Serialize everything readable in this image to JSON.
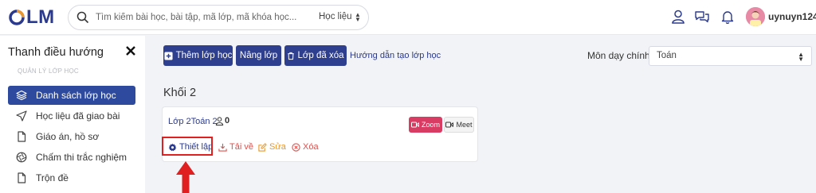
{
  "app": {
    "logo_text": "LM",
    "brand_color": "#2b3a8c"
  },
  "header": {
    "search_placeholder": "Tìm kiếm bài học, bài tập, mã lớp, mã khóa học...",
    "search_scope": "Học liệu",
    "icons": [
      "user-icon",
      "chat-icon",
      "bell-icon"
    ],
    "username": "uynuyn124"
  },
  "sidebar": {
    "title": "Thanh điều hướng",
    "section": "QUẢN LÝ LỚP HỌC",
    "items": [
      {
        "label": "Danh sách lớp học",
        "icon": "layers-icon",
        "active": true
      },
      {
        "label": "Học liệu đã giao bài",
        "icon": "send-icon",
        "active": false
      },
      {
        "label": "Giáo án, hồ sơ",
        "icon": "file-icon",
        "active": false
      },
      {
        "label": "Chấm thi trắc nghiệm",
        "icon": "aperture-icon",
        "active": false
      },
      {
        "label": "Trộn đề",
        "icon": "file-icon",
        "active": false
      }
    ]
  },
  "toolbar": {
    "add_class": "Thêm lớp học",
    "upgrade_class": "Nâng lớp",
    "deleted_classes": "Lớp đã xóa",
    "help_link": "Hướng dẫn tạo lớp học",
    "subject_label": "Môn dạy chính",
    "subject_value": "Toán"
  },
  "grade": {
    "title": "Khối 2"
  },
  "class_card": {
    "name": "Lớp 2Toán 2",
    "student_count": "0",
    "zoom_label": "Zoom",
    "meet_label": "Meet",
    "actions": {
      "settings": "Thiết lập",
      "download": "Tải về",
      "edit": "Sửa",
      "delete": "Xóa"
    }
  },
  "colors": {
    "primary": "#2e3f8f",
    "active_nav": "#2e4a9e",
    "zoom": "#d93c62",
    "download": "#d9534f",
    "edit": "#e8962e",
    "delete": "#d9534f",
    "highlight": "#e02020"
  }
}
